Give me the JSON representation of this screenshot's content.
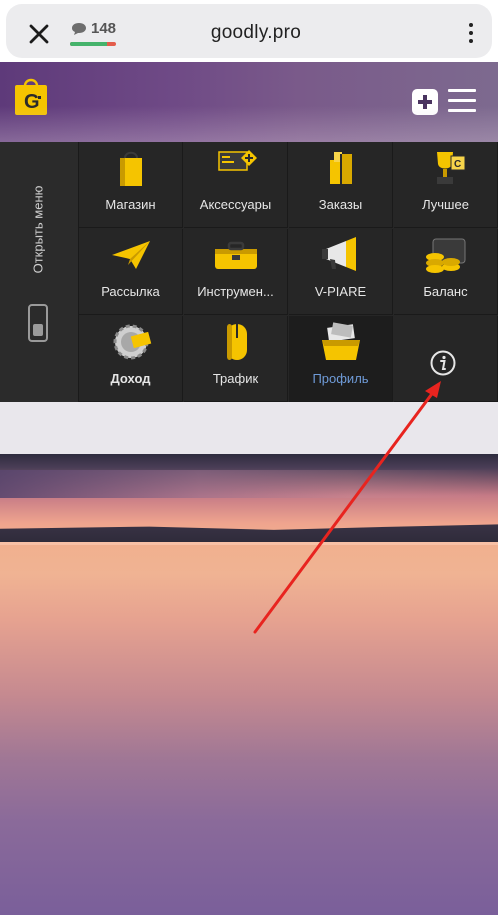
{
  "browser": {
    "close_icon": "close-icon",
    "comment_count": "148",
    "comment_bar_fill": 0.8,
    "url": "goodly.pro",
    "menu_icon": "kebab-icon"
  },
  "header": {
    "logo_letter": "G",
    "accent": "#f5c400"
  },
  "side_menu": {
    "label": "Открыть меню"
  },
  "menu": {
    "items": [
      {
        "label": "Магазин",
        "icon": "shopping-bag-icon"
      },
      {
        "label": "Аксессуары",
        "icon": "accessories-icon"
      },
      {
        "label": "Заказы",
        "icon": "orders-icon"
      },
      {
        "label": "Лучшее",
        "icon": "trophy-icon"
      },
      {
        "label": "Рассылка",
        "icon": "paper-plane-icon"
      },
      {
        "label": "Инструмен...",
        "icon": "toolbox-icon"
      },
      {
        "label": "V-PIARE",
        "icon": "megaphone-icon"
      },
      {
        "label": "Баланс",
        "icon": "wallet-coins-icon"
      },
      {
        "label": "Доход",
        "icon": "gear-money-icon"
      },
      {
        "label": "Трафик",
        "icon": "mouse-icon"
      },
      {
        "label": "Профиль",
        "icon": "profile-box-icon"
      }
    ],
    "info_icon": "info-icon"
  },
  "colors": {
    "annotation_arrow": "#e8241f",
    "active_label": "#6f9bd8"
  }
}
